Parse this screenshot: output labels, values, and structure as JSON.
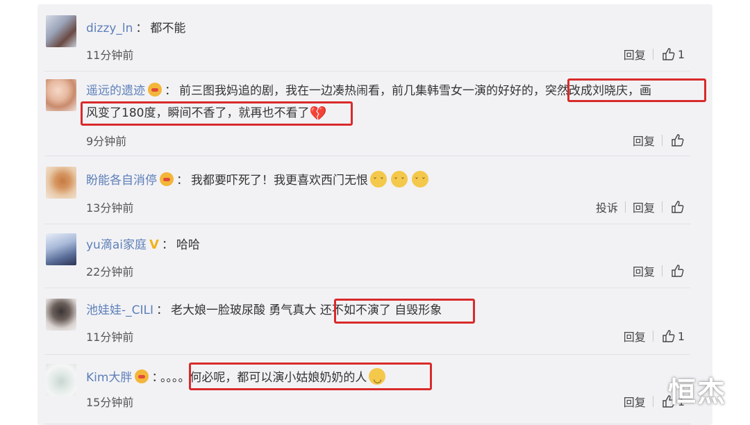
{
  "comments": [
    {
      "username": "dizzy_ln",
      "text": "都不能",
      "time": "11分钟前",
      "reply": "回复",
      "likes": "1"
    },
    {
      "username": "遥远的遗迹",
      "text_line1": "前三图我妈追的剧，我在一边凑热闹看，前几集韩雪女一演的好好的，",
      "text_line1_hl": "突然改成刘晓庆，画",
      "text_line2_hl": "风变了180度，瞬间不香了，就再也不看了",
      "time": "9分钟前",
      "reply": "回复"
    },
    {
      "username": "盼能各自消停",
      "text": "我都要吓死了！我更喜欢西门无恨",
      "time": "13分钟前",
      "report": "投诉",
      "reply": "回复"
    },
    {
      "username": "yu滴ai家庭",
      "text": "哈哈",
      "time": "22分钟前",
      "reply": "回复"
    },
    {
      "username": "池娃娃-_CILI",
      "text": "老大娘一脸玻尿酸 勇气真大 ",
      "text_hl": "还不如不演了 自毁形象",
      "time": "11分钟前",
      "reply": "回复",
      "likes": "1"
    },
    {
      "username": "Kim大胖",
      "text": "。。。",
      "text_hl": "。何必呢，都可以演小姑娘奶奶的人",
      "time": "15分钟前",
      "reply": "回复",
      "likes": "1"
    }
  ],
  "separator": "：",
  "watermark": "恒杰",
  "icons": {
    "badge": "emoji-badge-icon",
    "vip": "v-badge-icon",
    "like": "thumbs-up-icon",
    "broken_heart": "broken-heart-icon",
    "cat": "cat-face-icon",
    "smile": "smile-icon"
  },
  "colors": {
    "username": "#5d7fb8",
    "highlight_box": "#d92a2a",
    "panel": "#f2f2f5"
  }
}
